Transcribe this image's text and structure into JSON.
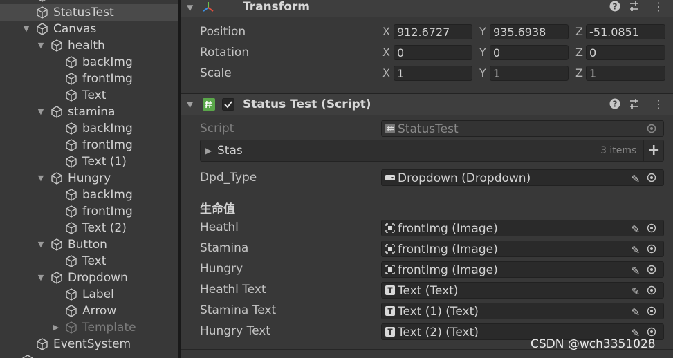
{
  "hierarchy": {
    "items": [
      {
        "label": "StatusTest",
        "selected": true
      },
      {
        "label": "Canvas"
      },
      {
        "label": "health"
      },
      {
        "label": "backImg"
      },
      {
        "label": "frontImg"
      },
      {
        "label": "Text"
      },
      {
        "label": "stamina"
      },
      {
        "label": "backImg"
      },
      {
        "label": "frontImg"
      },
      {
        "label": "Text (1)"
      },
      {
        "label": "Hungry"
      },
      {
        "label": "backImg"
      },
      {
        "label": "frontImg"
      },
      {
        "label": "Text (2)"
      },
      {
        "label": "Button"
      },
      {
        "label": "Text"
      },
      {
        "label": "Dropdown"
      },
      {
        "label": "Label"
      },
      {
        "label": "Arrow"
      },
      {
        "label": "Template",
        "dimmed": true
      },
      {
        "label": "EventSystem"
      }
    ]
  },
  "transform": {
    "title": "Transform",
    "position": {
      "label": "Position",
      "x": "912.6727",
      "y": "935.6938",
      "z": "-51.0851"
    },
    "rotation": {
      "label": "Rotation",
      "x": "0",
      "y": "0",
      "z": "0"
    },
    "scale": {
      "label": "Scale",
      "x": "1",
      "y": "1",
      "z": "1"
    },
    "axes": {
      "x": "X",
      "y": "Y",
      "z": "Z"
    }
  },
  "script_component": {
    "title": "Status Test (Script)",
    "enabled": true,
    "script": {
      "label": "Script",
      "value": "StatusTest"
    },
    "stas": {
      "label": "Stas",
      "count": "3 items"
    },
    "dpd_type": {
      "label": "Dpd_Type",
      "value": "Dropdown (Dropdown)"
    },
    "section_header": "生命值",
    "fields": [
      {
        "label": "Heathl",
        "value": "frontImg (Image)",
        "icon": "image-icon"
      },
      {
        "label": "Stamina",
        "value": "frontImg (Image)",
        "icon": "image-icon"
      },
      {
        "label": "Hungry",
        "value": "frontImg (Image)",
        "icon": "image-icon"
      },
      {
        "label": "Heathl Text",
        "value": "Text (Text)",
        "icon": "text-icon"
      },
      {
        "label": "Stamina Text",
        "value": "Text (1) (Text)",
        "icon": "text-icon"
      },
      {
        "label": "Hungry Text",
        "value": "Text (2) (Text)",
        "icon": "text-icon"
      }
    ]
  },
  "watermark": "CSDN @wch3351028",
  "colors": {
    "background": "#383838",
    "field": "#2a2a2a",
    "text": "#c4c4c4",
    "selected_row": "#4a4a4a"
  }
}
